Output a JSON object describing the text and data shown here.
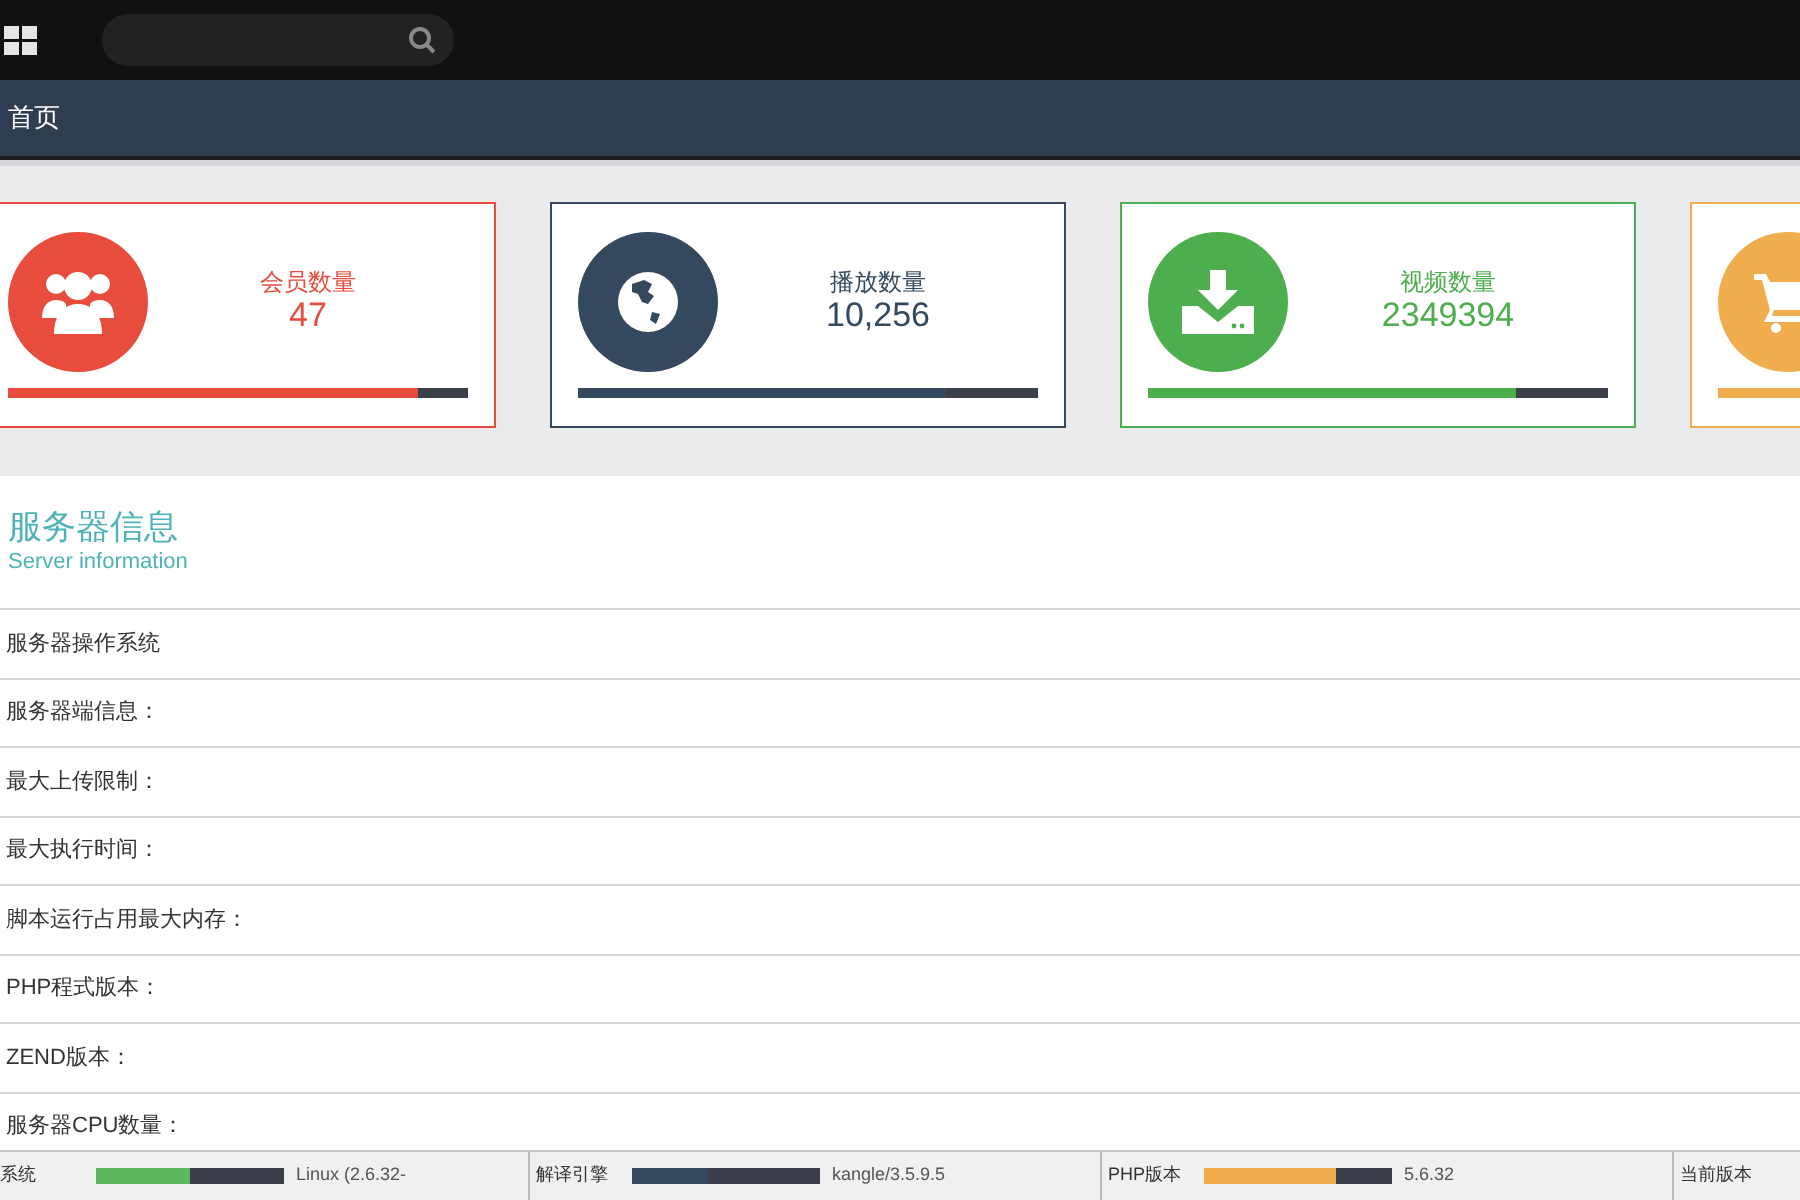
{
  "breadcrumb": "首页",
  "stats": [
    {
      "label": "会员数量",
      "value": "47",
      "color": "#e74c3c",
      "level": 0.89,
      "kind": "users"
    },
    {
      "label": "播放数量",
      "value": "10,256",
      "color": "#34495e",
      "level": 0.8,
      "kind": "globe"
    },
    {
      "label": "视频数量",
      "value": "2349394",
      "color": "#4cae4c",
      "level": 0.8,
      "kind": "download"
    },
    {
      "color": "#f0ad4e",
      "kind": "cart"
    }
  ],
  "server": {
    "title": "服务器信息",
    "subtitle": "Server information",
    "rows": [
      "服务器操作系统",
      "服务器端信息：",
      "最大上传限制：",
      "最大执行时间：",
      "脚本运行占用最大内存：",
      "PHP程式版本：",
      "ZEND版本：",
      "服务器CPU数量："
    ]
  },
  "status_bar": [
    {
      "label": "系统",
      "color": "#5cb85c",
      "level": 0.5,
      "value": "Linux (2.6.32-"
    },
    {
      "label": "解译引擎",
      "color": "#34495e",
      "level": 0.4,
      "value": "kangle/3.5.9.5"
    },
    {
      "label": "PHP版本",
      "color": "#f0ad4e",
      "level": 0.7,
      "value": "5.6.32"
    },
    {
      "label": "当前版本"
    }
  ]
}
